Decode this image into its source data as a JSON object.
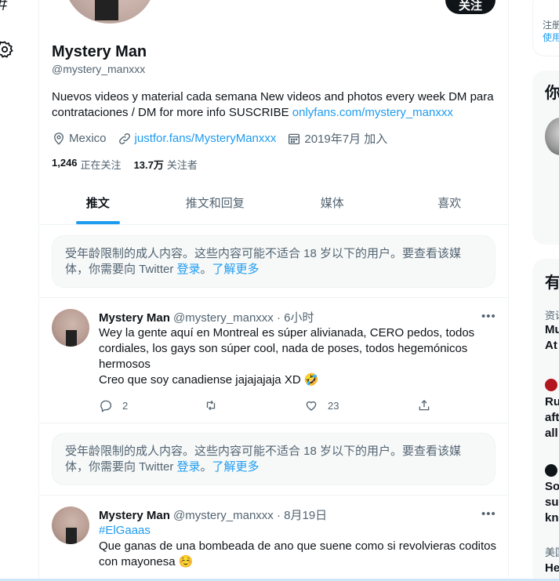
{
  "profile": {
    "name": "Mystery Man",
    "handle": "@mystery_manxxx",
    "follow_label": "关注",
    "bio_text": "Nuevos videos y material cada semana New videos and photos every week DM para contrataciones / DM for more info SUSCRIBE ",
    "bio_link": "onlyfans.com/mystery_manxxx",
    "location": "Mexico",
    "website": "justfor.fans/MysteryManxxx",
    "joined": "2019年7月 加入",
    "following_count": "1,246",
    "following_label": "正在关注",
    "followers_count": "13.7万",
    "followers_label": "关注者"
  },
  "tabs": [
    {
      "label": "推文",
      "active": true
    },
    {
      "label": "推文和回复",
      "active": false
    },
    {
      "label": "媒体",
      "active": false
    },
    {
      "label": "喜欢",
      "active": false
    }
  ],
  "warning": {
    "text": "受年龄限制的成人内容。这些内容可能不适合 18 岁以下的用户。要查看该媒体，你需要向 Twitter ",
    "login": "登录",
    "sep": "。",
    "learn_more": "了解更多"
  },
  "tweets": [
    {
      "name": "Mystery Man",
      "handle": "@mystery_manxxx",
      "time": "6小时",
      "lines": [
        "Wey la gente aquí en Montreal es súper alivianada, CERO pedos, todos",
        "cordiales, los gays son súper cool, nada de poses, todos hegemónicos",
        "hermosos",
        "Creo que soy canadiense jajajajaja XD 🤣"
      ],
      "replies": "2",
      "retweets": "",
      "likes": "23"
    },
    {
      "name": "Mystery Man",
      "handle": "@mystery_manxxx",
      "time": "8月19日",
      "hashtag": "#ElGaaas",
      "lines": [
        "Que ganas de una bombeada de ano que suene como si revolvieras coditos",
        "con mayonesa ☺️"
      ]
    }
  ],
  "right": {
    "top_text1": "注册",
    "top_text2": "使用",
    "box1_heading": "你",
    "box2_heading": "有",
    "trend1_small": "资讯",
    "trend1_l1": "Mu",
    "trend1_l2": "At",
    "trend2_l1": "Ru",
    "trend2_l2": "aft",
    "trend2_l3": "all",
    "trend3_l1": "So",
    "trend3_l2": "su",
    "trend3_l3": "kn",
    "trend4_small": "美国",
    "trend4_l1": "He"
  },
  "colors": {
    "accent": "#1d9bf0",
    "text": "#0f1419",
    "muted": "#536471"
  }
}
